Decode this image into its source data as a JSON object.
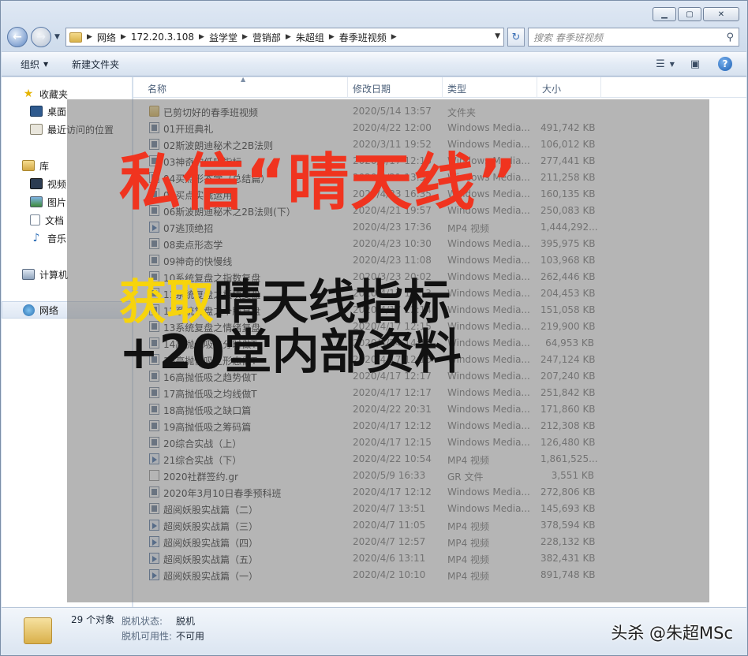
{
  "window": {
    "controls": [
      "minimize",
      "maximize",
      "close"
    ]
  },
  "address": {
    "crumbs": [
      "网络",
      "172.20.3.108",
      "益学堂",
      "营销部",
      "朱超组",
      "春季班视频"
    ]
  },
  "search": {
    "placeholder": "搜索 春季班视频"
  },
  "toolbar": {
    "organize": "组织",
    "new_folder": "新建文件夹"
  },
  "sidebar": {
    "favorites": "收藏夹",
    "desktop": "桌面",
    "recent": "最近访问的位置",
    "libraries": "库",
    "videos": "视频",
    "pictures": "图片",
    "documents": "文档",
    "music": "音乐",
    "computer": "计算机",
    "network": "网络"
  },
  "columns": {
    "name": "名称",
    "date": "修改日期",
    "type": "类型",
    "size": "大小"
  },
  "files": [
    {
      "name": "已剪切好的春季班视频",
      "date": "2020/5/14 13:57",
      "type": "文件夹",
      "size": "",
      "icon": "folder"
    },
    {
      "name": "01开班典礼",
      "date": "2020/4/22 12:00",
      "type": "Windows Media...",
      "size": "491,742 KB",
      "icon": "wmv"
    },
    {
      "name": "02斯波朗迪秘术之2B法则",
      "date": "2020/3/11 19:52",
      "type": "Windows Media...",
      "size": "106,012 KB",
      "icon": "wmv"
    },
    {
      "name": "03神奇的低吸指标",
      "date": "2020/4/17 12:16",
      "type": "Windows Media...",
      "size": "277,441 KB",
      "icon": "wmv"
    },
    {
      "name": "04买点形态学（总结篇）",
      "date": "2020/4/21 13:51",
      "type": "Windows Media...",
      "size": "211,258 KB",
      "icon": "wmv"
    },
    {
      "name": "05买点实战运用",
      "date": "2020/4/23 16:35",
      "type": "Windows Media...",
      "size": "160,135 KB",
      "icon": "wmv"
    },
    {
      "name": "06斯波朗迪秘术之2B法则(下）",
      "date": "2020/4/21 19:57",
      "type": "Windows Media...",
      "size": "250,083 KB",
      "icon": "wmv"
    },
    {
      "name": "07逃顶绝招",
      "date": "2020/4/23 17:36",
      "type": "MP4 视频",
      "size": "1,444,292...",
      "icon": "mp4"
    },
    {
      "name": "08卖点形态学",
      "date": "2020/4/23 10:30",
      "type": "Windows Media...",
      "size": "395,975 KB",
      "icon": "wmv"
    },
    {
      "name": "09神奇的快慢线",
      "date": "2020/4/23 11:08",
      "type": "Windows Media...",
      "size": "103,968 KB",
      "icon": "wmv"
    },
    {
      "name": "10系统复盘之指数复盘",
      "date": "2020/3/23 20:02",
      "type": "Windows Media...",
      "size": "262,446 KB",
      "icon": "wmv"
    },
    {
      "name": "11系统复盘之板块复盘",
      "date": "2020/4/17 12:13",
      "type": "Windows Media...",
      "size": "204,453 KB",
      "icon": "wmv"
    },
    {
      "name": "12系统复盘之个股复盘",
      "date": "2020/4/17 12:14",
      "type": "Windows Media...",
      "size": "151,058 KB",
      "icon": "wmv"
    },
    {
      "name": "13系统复盘之情绪复盘",
      "date": "2020/4/17 12:15",
      "type": "Windows Media...",
      "size": "219,900 KB",
      "icon": "wmv"
    },
    {
      "name": "14高抛低吸之分时做T",
      "date": "2020/4/24 14:16",
      "type": "Windows Media...",
      "size": "64,953 KB",
      "icon": "wmv"
    },
    {
      "name": "15高抛低吸之形态做T",
      "date": "2020/4/17 12:16",
      "type": "Windows Media...",
      "size": "247,124 KB",
      "icon": "wmv"
    },
    {
      "name": "16高抛低吸之趋势做T",
      "date": "2020/4/17 12:17",
      "type": "Windows Media...",
      "size": "207,240 KB",
      "icon": "wmv"
    },
    {
      "name": "17高抛低吸之均线做T",
      "date": "2020/4/17 12:17",
      "type": "Windows Media...",
      "size": "251,842 KB",
      "icon": "wmv"
    },
    {
      "name": "18高抛低吸之缺口篇",
      "date": "2020/4/22 20:31",
      "type": "Windows Media...",
      "size": "171,860 KB",
      "icon": "wmv"
    },
    {
      "name": "19高抛低吸之筹码篇",
      "date": "2020/4/17 12:12",
      "type": "Windows Media...",
      "size": "212,308 KB",
      "icon": "wmv"
    },
    {
      "name": "20综合实战（上）",
      "date": "2020/4/17 12:15",
      "type": "Windows Media...",
      "size": "126,480 KB",
      "icon": "wmv"
    },
    {
      "name": "21综合实战（下）",
      "date": "2020/4/22 10:54",
      "type": "MP4 视频",
      "size": "1,861,525...",
      "icon": "mp4"
    },
    {
      "name": "2020社群签约.gr",
      "date": "2020/5/9 16:33",
      "type": "GR 文件",
      "size": "3,551 KB",
      "icon": "gr"
    },
    {
      "name": "2020年3月10日春季预科班",
      "date": "2020/4/17 12:12",
      "type": "Windows Media...",
      "size": "272,806 KB",
      "icon": "wmv"
    },
    {
      "name": "超阅妖股实战篇（二）",
      "date": "2020/4/7 13:51",
      "type": "Windows Media...",
      "size": "145,693 KB",
      "icon": "wmv"
    },
    {
      "name": "超阅妖股实战篇（三）",
      "date": "2020/4/7 11:05",
      "type": "MP4 视频",
      "size": "378,594 KB",
      "icon": "mp4"
    },
    {
      "name": "超阅妖股实战篇（四）",
      "date": "2020/4/7 12:57",
      "type": "MP4 视频",
      "size": "228,132 KB",
      "icon": "mp4"
    },
    {
      "name": "超阅妖股实战篇（五）",
      "date": "2020/4/6 13:11",
      "type": "MP4 视频",
      "size": "382,431 KB",
      "icon": "mp4"
    },
    {
      "name": "超阅妖股实战篇（一）",
      "date": "2020/4/2 10:10",
      "type": "MP4 视频",
      "size": "891,748 KB",
      "icon": "mp4"
    }
  ],
  "overlay": {
    "headline": "私信“晴天线”",
    "sub_highlight": "获取",
    "sub_rest": "晴天线指标+20堂内部资料"
  },
  "status": {
    "count": "29 个对象",
    "offline_status_label": "脱机状态:",
    "offline_status_value": "脱机",
    "offline_avail_label": "脱机可用性:",
    "offline_avail_value": "不可用"
  },
  "watermark": "头杀 @朱超MSc"
}
